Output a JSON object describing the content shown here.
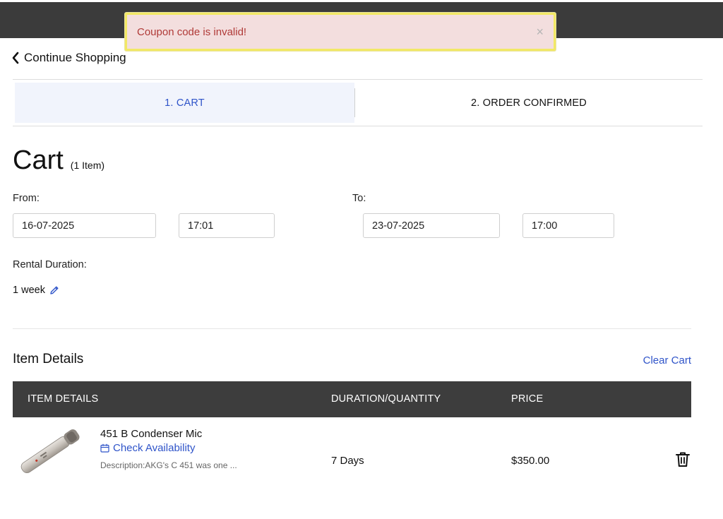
{
  "toast": {
    "message": "Coupon code is invalid!",
    "close_glyph": "×"
  },
  "nav": {
    "continue_label": "Continue Shopping"
  },
  "steps": [
    {
      "label": "1. CART",
      "active": true
    },
    {
      "label": "2. ORDER CONFIRMED",
      "active": false
    }
  ],
  "cart": {
    "title": "Cart",
    "count_label": "(1 Item)"
  },
  "from": {
    "label": "From:",
    "date": "16-07-2025",
    "time": "17:01"
  },
  "to": {
    "label": "To:",
    "date": "23-07-2025",
    "time": "17:00"
  },
  "rental": {
    "label": "Rental Duration:",
    "value": "1 week",
    "edit_icon": "pencil-icon"
  },
  "items_section": {
    "title": "Item Details",
    "clear_label": "Clear Cart"
  },
  "table": {
    "headers": [
      "ITEM DETAILS",
      "DURATION/QUANTITY",
      "PRICE"
    ],
    "rows": [
      {
        "name": "451 B Condenser Mic",
        "availability_label": "Check Availability",
        "description": "Description:AKG's C 451 was one ...",
        "duration": "7 Days",
        "price": "$350.00"
      }
    ]
  },
  "colors": {
    "accent": "#2f54c9",
    "header_bg": "#3d3d3d",
    "toast_bg": "#f3dede",
    "toast_text": "#b03a37",
    "toast_border": "#f2e866"
  }
}
